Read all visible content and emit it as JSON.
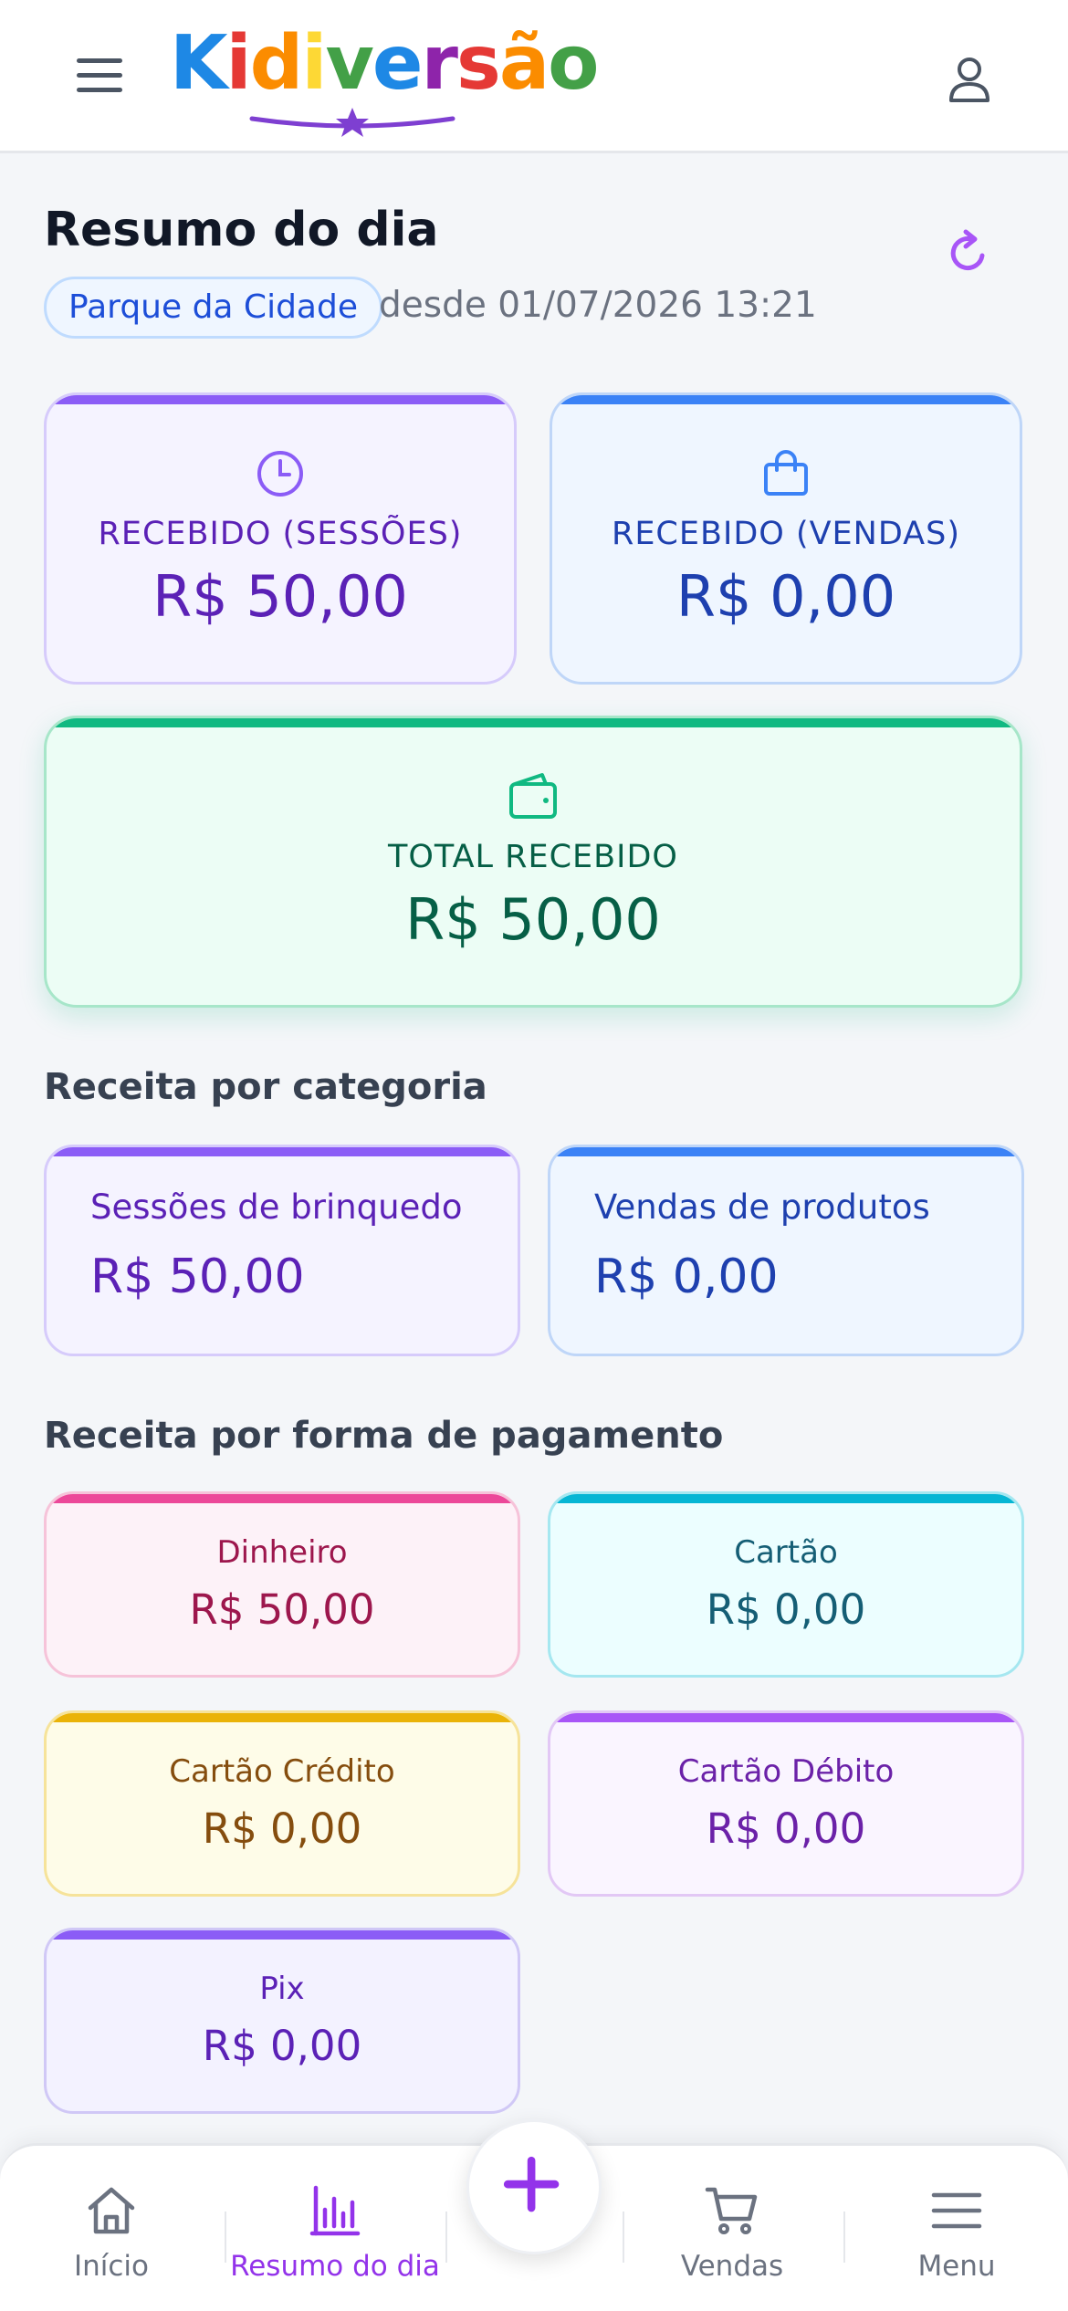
{
  "header": {
    "logo_text": "Kidiversão",
    "logo_letters": [
      {
        "char": "K",
        "color": "#1e88e5"
      },
      {
        "char": "i",
        "color": "#e53935"
      },
      {
        "char": "d",
        "color": "#fb8c00"
      },
      {
        "char": "i",
        "color": "#fdd835"
      },
      {
        "char": "v",
        "color": "#43a047"
      },
      {
        "char": "e",
        "color": "#1e88e5"
      },
      {
        "char": "r",
        "color": "#8e24aa"
      },
      {
        "char": "s",
        "color": "#e53935"
      },
      {
        "char": "ã",
        "color": "#fb8c00"
      },
      {
        "char": "o",
        "color": "#43a047"
      }
    ]
  },
  "page": {
    "title": "Resumo do dia",
    "location": "Parque da Cidade",
    "since": "desde 01/07/2026 13:21"
  },
  "summary": {
    "sessions": {
      "label": "RECEBIDO (SESSÕES)",
      "value": "R$ 50,00"
    },
    "sales": {
      "label": "RECEBIDO (VENDAS)",
      "value": "R$ 0,00"
    },
    "total": {
      "label": "TOTAL RECEBIDO",
      "value": "R$ 50,00"
    }
  },
  "by_category": {
    "title": "Receita por categoria",
    "items": [
      {
        "label": "Sessões de brinquedo",
        "value": "R$ 50,00"
      },
      {
        "label": "Vendas de produtos",
        "value": "R$ 0,00"
      }
    ]
  },
  "by_payment": {
    "title": "Receita por forma de pagamento",
    "items": [
      {
        "label": "Dinheiro",
        "value": "R$ 50,00"
      },
      {
        "label": "Cartão",
        "value": "R$ 0,00"
      },
      {
        "label": "Cartão Crédito",
        "value": "R$ 0,00"
      },
      {
        "label": "Cartão Débito",
        "value": "R$ 0,00"
      },
      {
        "label": "Pix",
        "value": "R$ 0,00"
      }
    ]
  },
  "nav": {
    "home": "Início",
    "summary": "Resumo do dia",
    "sales": "Vendas",
    "menu": "Menu"
  },
  "colors": {
    "accent": "#9333ea",
    "purple": "#8b5cf6",
    "blue": "#3b82f6",
    "green": "#10b981"
  }
}
